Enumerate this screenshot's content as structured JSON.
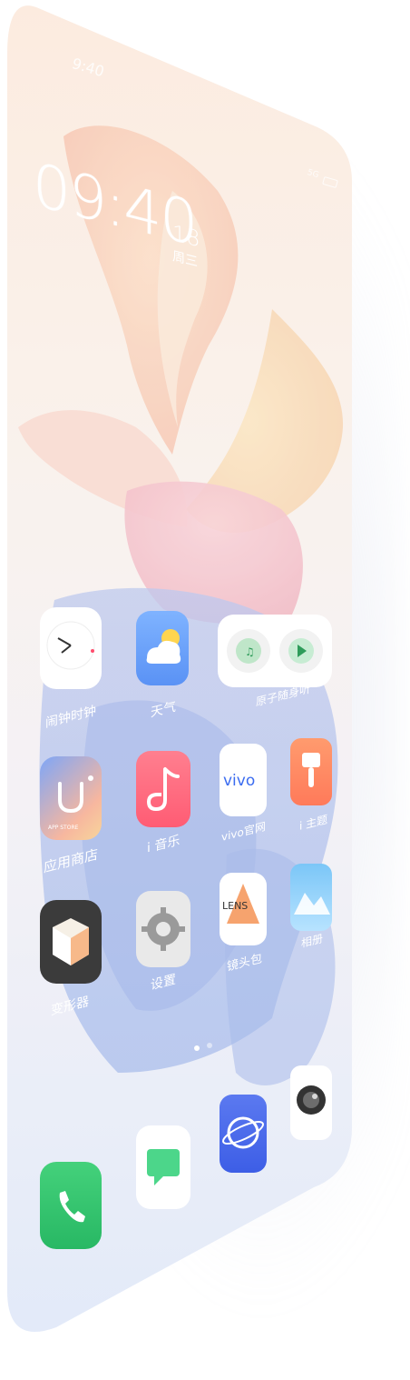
{
  "status_bar": {
    "time": "9:40",
    "right": "5G"
  },
  "lockclock": {
    "time": "09:40",
    "date": "18",
    "weekday": "周三"
  },
  "apps": {
    "row1": [
      {
        "label": "闹钟时钟",
        "icon": "clock-icon"
      },
      {
        "label": "天气",
        "icon": "weather-icon"
      },
      {
        "label": "原子随身听",
        "icon": "music-widget-icon"
      }
    ],
    "row2": [
      {
        "label": "应用商店",
        "icon": "app-store-icon",
        "badge": "APP STORE"
      },
      {
        "label": "i 音乐",
        "icon": "music-note-icon"
      },
      {
        "label": "vivo官网",
        "icon": "vivo-icon",
        "badge": "vivo"
      },
      {
        "label": "i 主题",
        "icon": "theme-brush-icon"
      }
    ],
    "row3": [
      {
        "label": "变形器",
        "icon": "cube-icon"
      },
      {
        "label": "设置",
        "icon": "gear-icon"
      },
      {
        "label": "镜头包",
        "icon": "lens-icon",
        "badge": "LENS"
      },
      {
        "label": "相册",
        "icon": "gallery-icon"
      }
    ]
  },
  "dock": [
    {
      "name": "phone",
      "icon": "phone-icon"
    },
    {
      "name": "messages",
      "icon": "message-icon"
    },
    {
      "name": "browser",
      "icon": "browser-icon"
    },
    {
      "name": "camera",
      "icon": "camera-icon"
    }
  ],
  "colors": {
    "peach": "#f6c9a6",
    "pink": "#f2a6b4",
    "blue": "#9cb7ec",
    "lightblue": "#cfdcf6"
  }
}
